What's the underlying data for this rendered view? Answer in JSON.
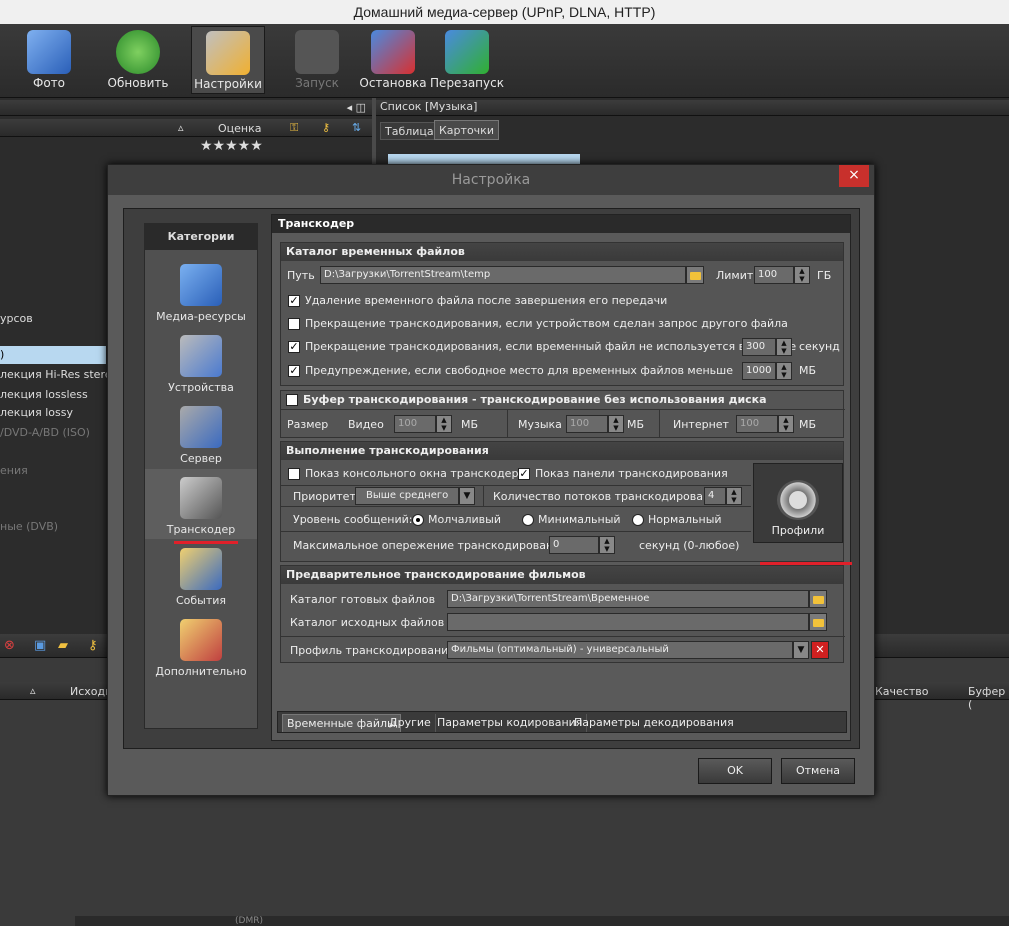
{
  "window": {
    "title": "Домашний медиа-сервер (UPnP, DLNA, HTTP)"
  },
  "toolbar": {
    "buttons": [
      {
        "label": "Фото"
      },
      {
        "label": "Обновить"
      },
      {
        "label": "Настройки"
      },
      {
        "label": "Запуск"
      },
      {
        "label": "Остановка"
      },
      {
        "label": "Перезапуск"
      }
    ]
  },
  "left_panel": {
    "column_rating": "Оценка",
    "rows": [
      "урсов",
      ")",
      "лекция Hi-Res stereo",
      "лекция lossless",
      "лекция lossy",
      "/DVD-A/BD (ISO)",
      "ения",
      "ные (DVB)"
    ]
  },
  "right_panel": {
    "header": "Список [Музыка]",
    "tabs": [
      "Таблица",
      "Карточки"
    ]
  },
  "bottom_panel": {
    "columns": [
      "Исходн",
      "Качество",
      "Буфер ("
    ],
    "status": "(DMR)"
  },
  "dialog": {
    "title": "Настройка",
    "close": "×",
    "categories_header": "Категории",
    "categories": [
      "Медиа-ресурсы",
      "Устройства",
      "Сервер",
      "Транскодер",
      "События",
      "Дополнительно"
    ],
    "section_title": "Транскодер",
    "temp": {
      "header": "Каталог временных файлов",
      "path_label": "Путь",
      "path_value": "D:\\Загрузки\\TorrentStream\\temp",
      "limit_label": "Лимит",
      "limit_value": "100",
      "limit_unit": "ГБ",
      "opt1": "Удаление временного файла после завершения его передачи",
      "opt2": "Прекращение транскодирования, если устройством сделан запрос другого файла",
      "opt3": "Прекращение транскодирования, если временный файл не используется в течение",
      "opt3_value": "300",
      "opt3_unit": "секунд",
      "opt4": "Предупреждение, если свободное место для временных файлов меньше",
      "opt4_value": "1000",
      "opt4_unit": "МБ"
    },
    "buffer": {
      "header": "Буфер транскодирования - транскодирование без использования диска",
      "size_label": "Размер",
      "video_label": "Видео",
      "video_value": "100",
      "music_label": "Музыка",
      "music_value": "100",
      "internet_label": "Интернет",
      "internet_value": "100",
      "unit": "МБ"
    },
    "exec": {
      "header": "Выполнение транскодирования",
      "show_console": "Показ консольного окна транскодера",
      "show_panel": "Показ панели транскодирования",
      "priority_label": "Приоритет",
      "priority_value": "Выше среднего",
      "threads_label": "Количество потоков транскодирования",
      "threads_value": "4",
      "msg_level_label": "Уровень сообщений:",
      "msg_silent": "Молчаливый",
      "msg_min": "Минимальный",
      "msg_normal": "Нормальный",
      "max_ahead_label": "Максимальное опережение транскодирования",
      "max_ahead_value": "0",
      "max_ahead_unit": "секунд (0-любое)",
      "profiles_button": "Профили"
    },
    "pre": {
      "header": "Предварительное транскодирование фильмов",
      "ready_label": "Каталог готовых файлов",
      "ready_value": "D:\\Загрузки\\TorrentStream\\Временное",
      "source_label": "Каталог исходных файлов",
      "source_value": "",
      "profile_label": "Профиль транскодирования",
      "profile_value": "Фильмы (оптимальный) - универсальный"
    },
    "tabs": [
      "Временные файлы",
      "Другие",
      "Параметры кодирования",
      "Параметры декодирования"
    ],
    "ok": "OK",
    "cancel": "Отмена"
  },
  "colors": {
    "accent_red": "#e0202a",
    "dialog_bg": "#5a5a5a",
    "panel_dark": "#2c2c2c"
  }
}
